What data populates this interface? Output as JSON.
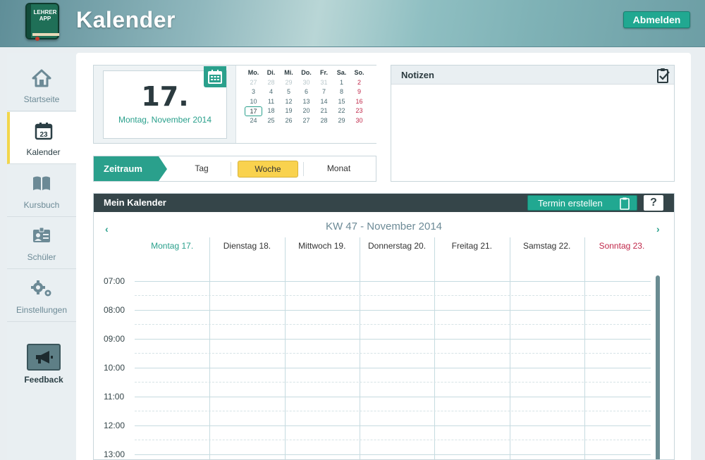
{
  "header": {
    "logo_text": "LEHRER APP",
    "title": "Kalender",
    "logout_label": "Abmelden"
  },
  "sidebar": {
    "items": [
      {
        "label": "Startseite",
        "icon": "home-icon"
      },
      {
        "label": "Kalender",
        "icon": "calendar-icon",
        "icon_text": "23",
        "active": true
      },
      {
        "label": "Kursbuch",
        "icon": "book-icon"
      },
      {
        "label": "Schüler",
        "icon": "id-card-icon"
      },
      {
        "label": "Einstellungen",
        "icon": "gears-icon"
      }
    ],
    "feedback_label": "Feedback"
  },
  "date_widget": {
    "day": "17.",
    "full_date": "Montag, November 2014"
  },
  "mini_calendar": {
    "weekdays": [
      "Mo.",
      "Di.",
      "Mi.",
      "Do.",
      "Fr.",
      "Sa.",
      "So."
    ],
    "weeks": [
      [
        "27",
        "28",
        "29",
        "30",
        "31",
        "1",
        "2"
      ],
      [
        "3",
        "4",
        "5",
        "6",
        "7",
        "8",
        "9"
      ],
      [
        "10",
        "11",
        "12",
        "13",
        "14",
        "15",
        "16"
      ],
      [
        "17",
        "18",
        "19",
        "20",
        "21",
        "22",
        "23"
      ],
      [
        "24",
        "25",
        "26",
        "27",
        "28",
        "29",
        "30"
      ]
    ],
    "muted_first_row_count": 5,
    "today": "17"
  },
  "zeitraum": {
    "label": "Zeitraum",
    "options": [
      "Tag",
      "Woche",
      "Monat"
    ],
    "selected": "Woche"
  },
  "notizen": {
    "title": "Notizen"
  },
  "calendar": {
    "title": "Mein Kalender",
    "create_label": "Termin erstellen",
    "help_label": "?",
    "prev_arrow": "‹",
    "next_arrow": "›",
    "week_title": "KW 47 - November 2014",
    "days": [
      "Montag 17.",
      "Dienstag 18.",
      "Mittwoch 19.",
      "Donnerstag 20.",
      "Freitag 21.",
      "Samstag 22.",
      "Sonntag 23."
    ],
    "hours": [
      "07:00",
      "08:00",
      "09:00",
      "10:00",
      "11:00",
      "12:00",
      "13:00"
    ]
  },
  "colors": {
    "accent": "#2aa08c",
    "highlight": "#f9d24e",
    "sunday": "#c0284a",
    "bar": "#354549"
  }
}
